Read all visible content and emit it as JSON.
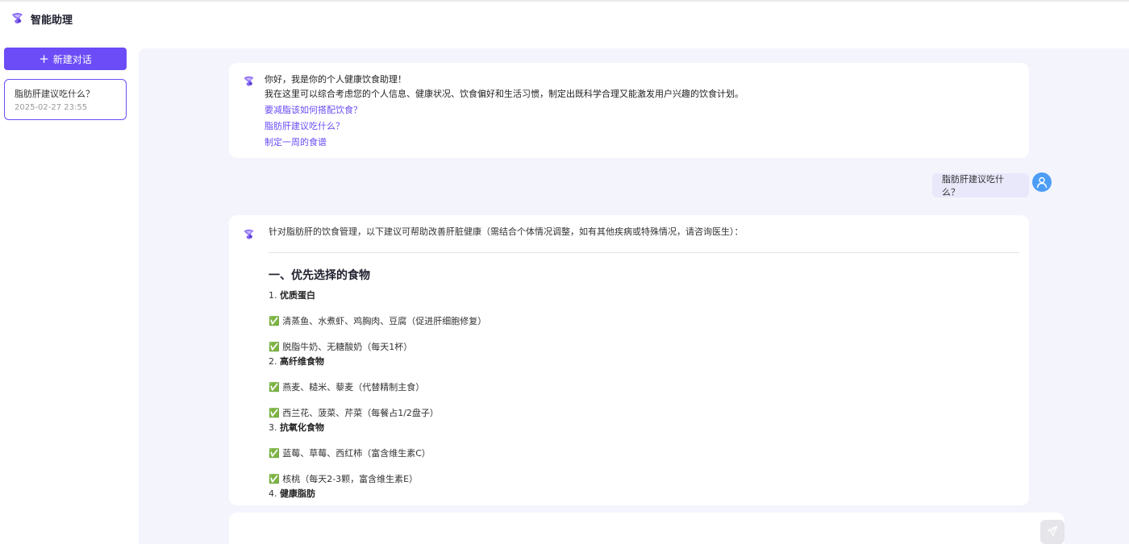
{
  "app": {
    "title": "智能助理"
  },
  "sidebar": {
    "new_chat_label": "新建对话",
    "conversations": [
      {
        "title": "脂肪肝建议吃什么？",
        "time": "2025-02-27 23:55"
      }
    ]
  },
  "welcome": {
    "line1": "你好，我是你的个人健康饮食助理！",
    "line2": "我在这里可以综合考虑您的个人信息、健康状况、饮食偏好和生活习惯，制定出既科学合理又能激发用户兴趣的饮食计划。",
    "suggestions": [
      "要减脂该如何搭配饮食？",
      "脂肪肝建议吃什么？",
      "制定一周的食谱"
    ]
  },
  "user_message": "脂肪肝建议吃什么？",
  "answer": {
    "intro": "针对脂肪肝的饮食管理，以下建议可帮助改善肝脏健康（需结合个体情况调整，如有其他疾病或特殊情况，请咨询医生）：",
    "heading": "一、优先选择的食物",
    "items": [
      {
        "num": "1.",
        "title": "优质蛋白",
        "bullets": [
          "✅ 清蒸鱼、水煮虾、鸡胸肉、豆腐（促进肝细胞修复）",
          "✅ 脱脂牛奶、无糖酸奶（每天1杯）"
        ]
      },
      {
        "num": "2.",
        "title": "高纤维食物",
        "bullets": [
          "✅ 燕麦、糙米、藜麦（代替精制主食）",
          "✅ 西兰花、菠菜、芹菜（每餐占1/2盘子）"
        ]
      },
      {
        "num": "3.",
        "title": "抗氧化食物",
        "bullets": [
          "✅ 蓝莓、草莓、西红柿（富含维生素C）",
          "✅ 核桃（每天2-3颗，富含维生素E）"
        ]
      },
      {
        "num": "4.",
        "title": "健康脂肪",
        "bullets": []
      }
    ]
  },
  "input": {
    "placeholder": ""
  },
  "colors": {
    "accent": "#6b4cf6",
    "main_bg": "#f4f4fd",
    "user_bubble": "#e9e8fb",
    "user_avatar": "#4d9df6"
  }
}
